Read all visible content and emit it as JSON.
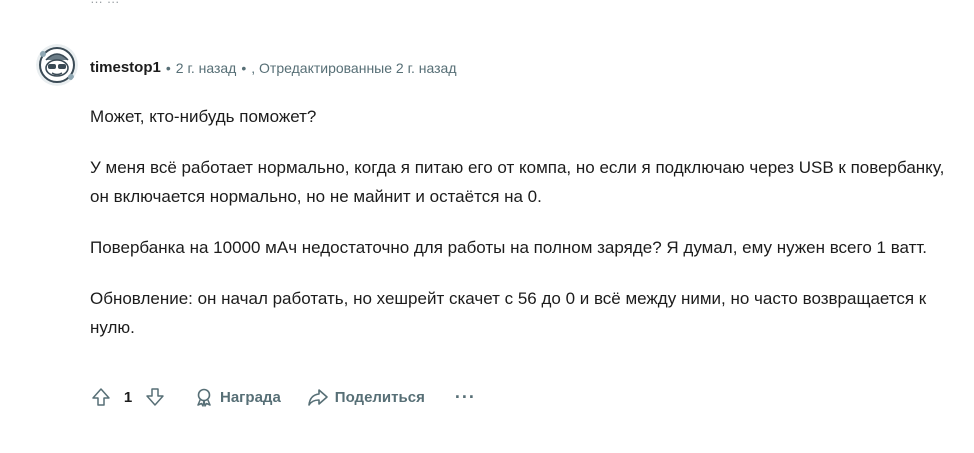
{
  "clipped_prev_comment": {
    "text": "… …"
  },
  "comment": {
    "author": "timestop1",
    "age": "2 г. назад",
    "separator": "•",
    "edited": ", Отредактированные 2 г. назад",
    "avatar_icon": "snoo-avatar-icon",
    "paragraphs": [
      "Может, кто-нибудь поможет?",
      "У меня всё работает нормально, когда я питаю его от компа, но если я подключаю через USB к повербанку, он включается нормально, но не майнит и остаётся на 0.",
      "Повербанка на 10000 мАч недостаточно для работы на полном заряде? Я думал, ему нужен всего 1 ватт.",
      "Обновление: он начал работать, но хешрейт скачет с 56 до 0 и всё между ними, но часто возвращается к нулю."
    ]
  },
  "actions": {
    "upvote_icon": "upvote-arrow-icon",
    "score": "1",
    "downvote_icon": "downvote-arrow-icon",
    "award_icon": "award-icon",
    "award_label": "Награда",
    "share_icon": "share-arrow-icon",
    "share_label": "Поделиться",
    "more_label": "···"
  },
  "colors": {
    "text": "#1c1c1c",
    "meta": "#576f76",
    "avatar_ring": "#3a4a55"
  }
}
